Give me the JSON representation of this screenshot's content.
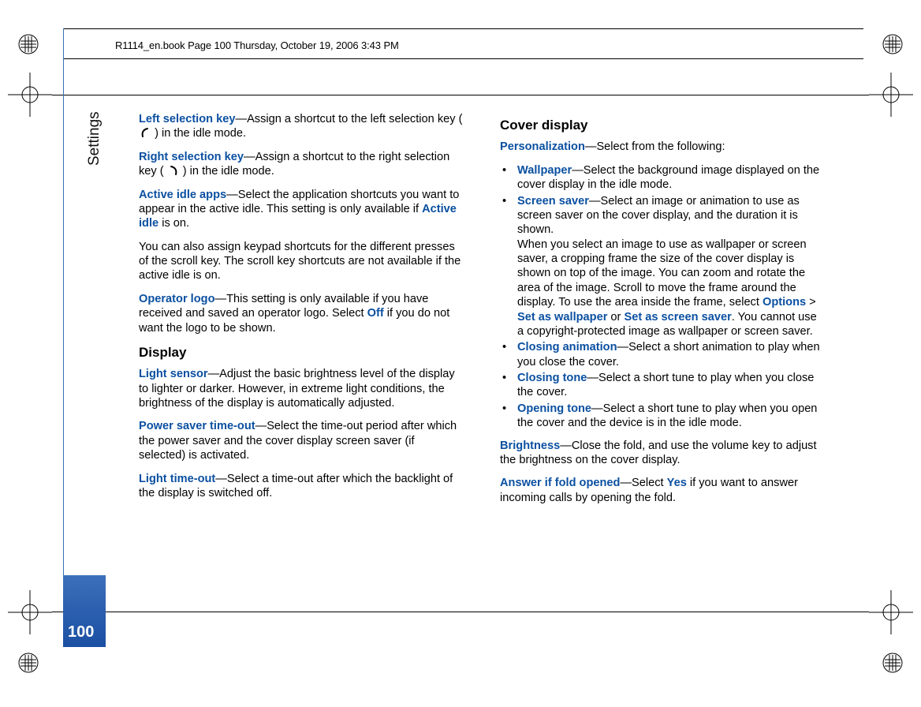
{
  "header": "R1114_en.book  Page 100  Thursday, October 19, 2006  3:43 PM",
  "sideLabel": "Settings",
  "pageNumber": "100",
  "col1": {
    "p1": {
      "lead": "Left selection key",
      "rest": "—Assign a shortcut to the left selection key (",
      "tail": ") in the idle mode."
    },
    "p2": {
      "lead": "Right selection key",
      "rest": "—Assign a shortcut to the right selection key (",
      "tail": ") in the idle mode."
    },
    "p3": {
      "lead": "Active idle apps",
      "rest": "—Select the application shortcuts you want to appear in the active idle. This setting is only available if ",
      "opt1": "Active idle",
      "tail": " is on."
    },
    "p4": "You can also assign keypad shortcuts for the different presses of the scroll key. The scroll key shortcuts are not available if the active idle is on.",
    "p5": {
      "lead": "Operator logo",
      "rest": "—This setting is only available if you have received and saved an operator logo. Select ",
      "opt1": "Off",
      "tail": " if you do not want the logo to be shown."
    },
    "h1": "Display",
    "p6": {
      "lead": "Light sensor",
      "rest": "—Adjust the basic brightness level of the display to lighter or darker. However, in extreme light conditions, the brightness of the display is automatically adjusted."
    },
    "p7": {
      "lead": "Power saver time-out",
      "rest": "—Select the time-out period after which the power saver and the cover display screen saver (if selected) is activated."
    },
    "p8": {
      "lead": "Light time-out",
      "rest": "—Select a time-out after which the backlight of the display is switched off."
    }
  },
  "col2": {
    "h1": "Cover display",
    "p1": {
      "lead": "Personalization",
      "rest": "—Select from the following:"
    },
    "bullets": [
      {
        "lead": "Wallpaper",
        "rest": "—Select the background image displayed on the cover display in the idle mode."
      },
      {
        "lead": "Screen saver",
        "rest": "—Select an image or animation to use as screen saver on the cover display, and the duration it is shown.",
        "cont1": "When you select an image to use as wallpaper or screen saver, a cropping frame the size of the cover display is shown on top of the image. You can zoom and rotate the area of the image. Scroll to move the frame around the display. To use the area inside the frame, select ",
        "opt1": "Options",
        "gt": " > ",
        "opt2": "Set as wallpaper",
        "or": " or ",
        "opt3": "Set as screen saver",
        "cont2": ". You cannot use a copyright-protected image as wallpaper or screen saver."
      },
      {
        "lead": "Closing animation",
        "rest": "—Select a short animation to play when you close the cover."
      },
      {
        "lead": "Closing tone",
        "rest": "—Select a short tune to play when you close the cover."
      },
      {
        "lead": "Opening tone",
        "rest": "—Select a short tune to play when you open the cover and the device is in the idle mode."
      }
    ],
    "p2": {
      "lead": "Brightness",
      "rest": "—Close the fold, and use the volume key to adjust the brightness on the cover display."
    },
    "p3": {
      "lead": "Answer if fold opened",
      "rest": "—Select ",
      "opt1": "Yes",
      "tail": " if you want to answer incoming calls by opening the fold."
    }
  }
}
